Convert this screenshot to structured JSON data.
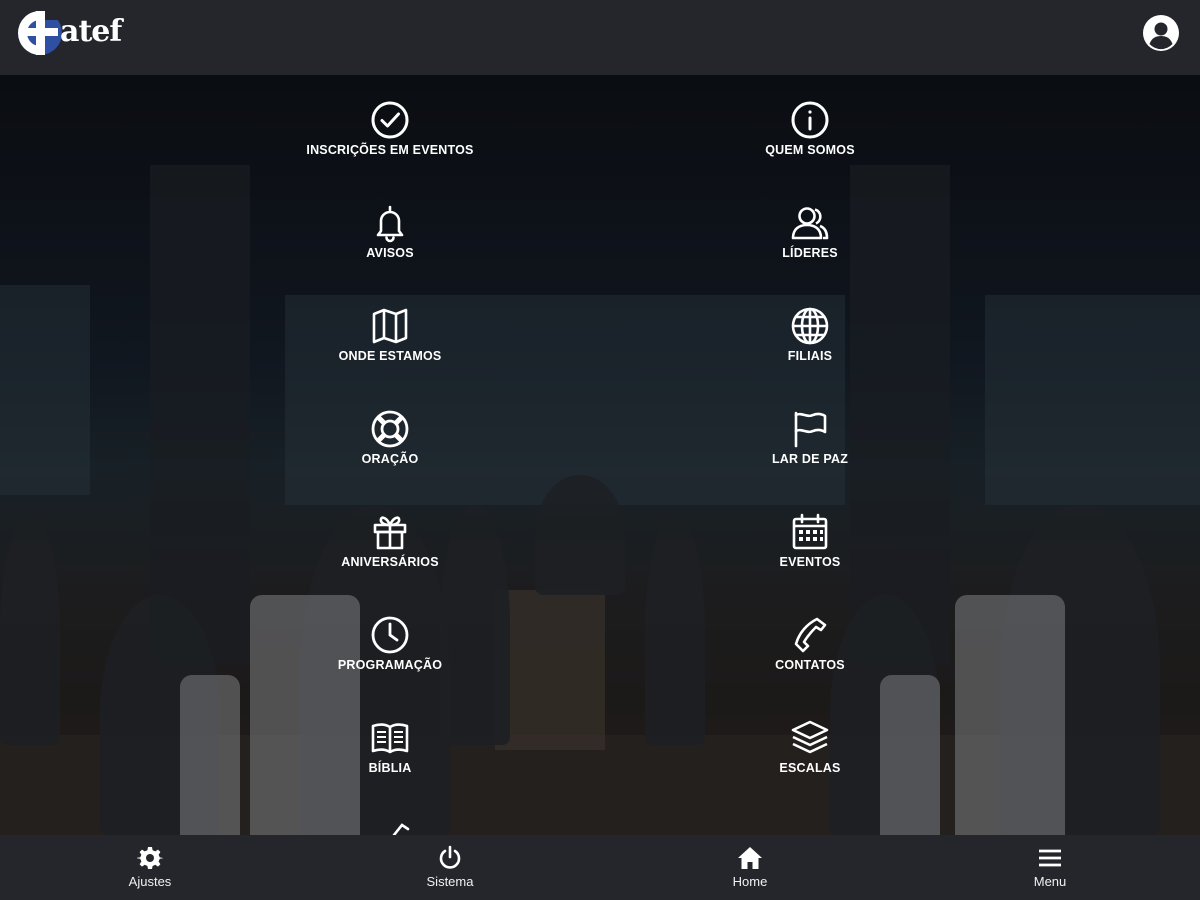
{
  "header": {
    "logo_text": "atef",
    "logo_subtitle": "",
    "profile_icon": "user-circle-icon"
  },
  "menu": {
    "left": [
      {
        "label": "INSCRIÇÕES EM EVENTOS",
        "icon": "check-circle-icon"
      },
      {
        "label": "AVISOS",
        "icon": "bell-icon"
      },
      {
        "label": "ONDE ESTAMOS",
        "icon": "map-icon"
      },
      {
        "label": "ORAÇÃO",
        "icon": "lifebuoy-icon"
      },
      {
        "label": "ANIVERSÁRIOS",
        "icon": "gift-icon"
      },
      {
        "label": "PROGRAMAÇÃO",
        "icon": "clock-icon"
      },
      {
        "label": "BÍBLIA",
        "icon": "book-open-icon"
      }
    ],
    "right": [
      {
        "label": "QUEM SOMOS",
        "icon": "info-circle-icon"
      },
      {
        "label": "LÍDERES",
        "icon": "users-icon"
      },
      {
        "label": "FILIAIS",
        "icon": "globe-icon"
      },
      {
        "label": "LAR DE PAZ",
        "icon": "flag-icon"
      },
      {
        "label": "EVENTOS",
        "icon": "calendar-icon"
      },
      {
        "label": "CONTATOS",
        "icon": "phone-icon"
      },
      {
        "label": "ESCALAS",
        "icon": "layers-icon"
      }
    ]
  },
  "bottom_nav": [
    {
      "label": "Ajustes",
      "icon": "gear-icon"
    },
    {
      "label": "Sistema",
      "icon": "power-icon"
    },
    {
      "label": "Home",
      "icon": "home-icon"
    },
    {
      "label": "Menu",
      "icon": "hamburger-icon"
    }
  ],
  "colors": {
    "header_bg": "#25262b",
    "nav_bg": "#25262b",
    "logo_blue": "#2f4fa3",
    "text": "#ffffff"
  }
}
